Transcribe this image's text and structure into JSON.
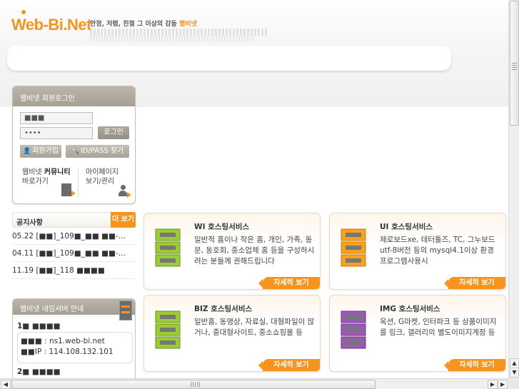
{
  "header": {
    "logo": "Web-Bi.Net",
    "slogan": "안정, 저렴, 친절 그 이상의 감동",
    "slogan_brand": "웹비넷"
  },
  "login": {
    "title": "웹비넷 회원로그인",
    "id_value": "■■■",
    "pw_value": "••••",
    "login_button": "로그인",
    "join_button": "회원가입",
    "find_button": "ID/PASS 찾기",
    "community_line1_a": "웹비넷 ",
    "community_line1_b": "커뮤니티",
    "community_line2": "바로가기",
    "mypage_line1": "마이페이지",
    "mypage_line2": "보기/관리"
  },
  "notice": {
    "title": "공지사항",
    "more": "더 보기",
    "items": [
      {
        "date": "05.22",
        "text": "[■■]_109■_■■ ■■-..."
      },
      {
        "date": "04.11",
        "text": "[■■]_109■_■■ ■■-..."
      },
      {
        "date": "11.19",
        "text": "[■■]_118 ■■■■"
      }
    ]
  },
  "nameserver": {
    "title": "웹비넷 네임서버 안내",
    "first_label": "1■ ■■■■",
    "ns_line": "■■■ : ns1.web-bi.net",
    "ip_line": "■■IP : 114.108.132.101",
    "second_label": "2■ ■■■■"
  },
  "services": [
    {
      "title": "WI 호스팅서비스",
      "desc": "일반적 홈이나 작은 홈, 개인, 가족, 동문, 동호회, 중소업체 홈 등을 구성하시려는 분들께 권해드립니다",
      "more": "자세히 보기",
      "color": "#9acd32"
    },
    {
      "title": "UI 호스팅서비스",
      "desc": "제로보드xe, 테터툴즈, TC, 그누보드 utf-8버전 등의 mysql4.1이상 환경 프로그램사용시",
      "more": "자세히 보기",
      "color": "#f7a11d"
    },
    {
      "title": "BIZ 호스팅서비스",
      "desc": "일반홈, 동영상, 자료실, 대형파일이 많거나, 중대형사이트, 중소쇼핑몰 등",
      "more": "자세히 보기",
      "color": "#9acd32"
    },
    {
      "title": "IMG 호스팅서비스",
      "desc": "옥션, G마켓, 인터파크 등 상품이미지를 링크, 갤러리의 별도이미지계정 등",
      "more": "자세히 보기",
      "color": "#9b59b6"
    }
  ],
  "colors": {
    "accent": "#f7941d",
    "panel": "#a69f93"
  }
}
